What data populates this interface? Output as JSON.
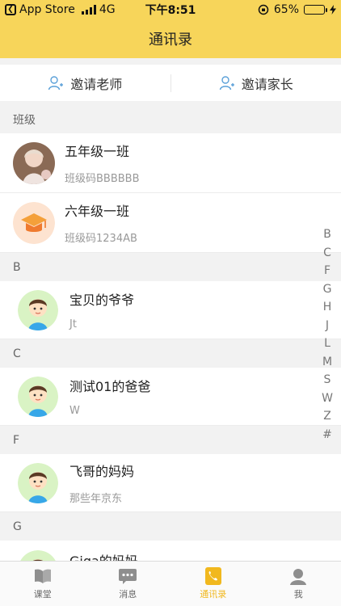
{
  "status_bar": {
    "back_app": "App Store",
    "network": "4G",
    "time": "下午8:51",
    "battery": "65%",
    "battery_level": 0.65
  },
  "nav": {
    "title": "通讯录"
  },
  "invite": {
    "teacher_label": "邀请老师",
    "parent_label": "邀请家长"
  },
  "sections": {
    "classes": "班级",
    "b": "B",
    "c": "C",
    "f": "F",
    "g": "G"
  },
  "classes": [
    {
      "name": "五年级一班",
      "code": "班级码BBBBBB"
    },
    {
      "name": "六年级一班",
      "code": "班级码1234AB"
    }
  ],
  "contacts": [
    {
      "name": "宝贝的爷爷",
      "sub": "Jt"
    },
    {
      "name": "测试01的爸爸",
      "sub": "W"
    },
    {
      "name": "飞哥的妈妈",
      "sub": "那些年京东"
    },
    {
      "name": "Giga的妈妈",
      "sub": ""
    }
  ],
  "index_letters": [
    "B",
    "C",
    "F",
    "G",
    "H",
    "J",
    "L",
    "M",
    "S",
    "W",
    "Z",
    "#"
  ],
  "tabs": [
    {
      "label": "课堂",
      "icon": "book-icon"
    },
    {
      "label": "消息",
      "icon": "message-icon"
    },
    {
      "label": "通讯录",
      "icon": "phone-icon",
      "active": true
    },
    {
      "label": "我",
      "icon": "person-icon"
    }
  ],
  "colors": {
    "header": "#f7d55a",
    "accent": "#f1b81e"
  }
}
